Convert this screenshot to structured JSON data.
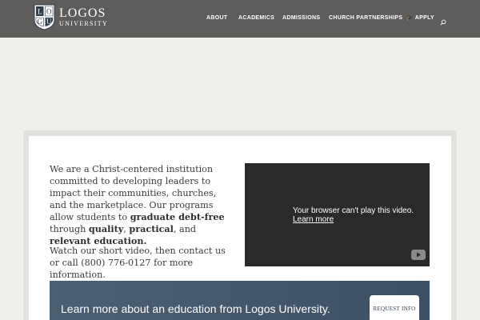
{
  "header": {
    "logo_title": "LOGOS",
    "logo_subtitle": "UNIVERSITY",
    "logo_shield_letters": [
      "L",
      "O",
      "G",
      "U"
    ],
    "nav": {
      "about": "ABOUT",
      "academics": "ACADEMICS",
      "admissions": "ADMISSIONS",
      "church": "CHURCH PARTNERSHIPS",
      "apply": "APPLY",
      "apply_icon": "graduation-cap-icon"
    },
    "search_icon": "search-icon"
  },
  "intro": {
    "p1_a": "We are a Christ-centered institution committed to developing leaders to impact their communities, churches, and the marketplace. Our programs allow students to ",
    "p1_b1": "graduate debt-free",
    "p1_c": " through ",
    "p1_b2": "quality",
    "p1_d": ", ",
    "p1_b3": "practical",
    "p1_e": ", and ",
    "p1_b4": "relevant education.",
    "p2": "Watch our short video, then contact us or call (800) 776-0127 for more information."
  },
  "video": {
    "message": "Your browser can't play this video.",
    "link": "Learn more"
  },
  "cta": {
    "text": "Learn more about an education from Logos University.",
    "button": "REQUEST INFO"
  },
  "colors": {
    "header_bg": "#5e5d5b",
    "page_bg": "#f0efea",
    "cta_bg": "#45576b",
    "video_bg": "#2a2a2a"
  }
}
